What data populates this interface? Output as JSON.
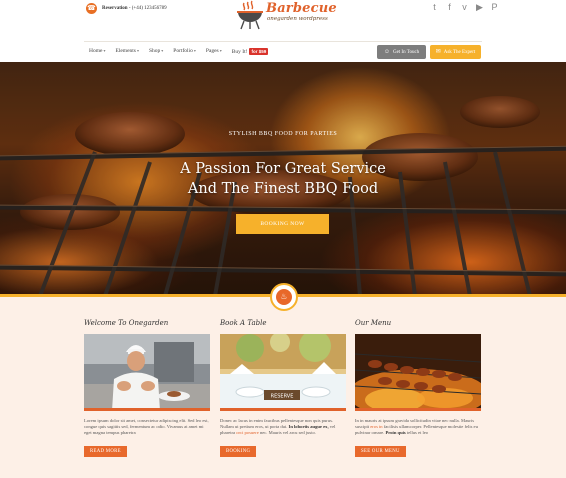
{
  "topbar": {
    "reservation_label": "Reservation",
    "reservation_phone": "- (+44) 123456789",
    "logo_title": "Barbecue",
    "logo_subtitle": "onegarden wordpress",
    "social_icons": [
      "twitter-icon",
      "facebook-icon",
      "vimeo-icon",
      "youtube-icon",
      "pinterest-icon"
    ],
    "social_glyphs": [
      "t",
      "f",
      "v",
      "▶",
      "P"
    ]
  },
  "nav": {
    "items": [
      "Home",
      "Elements",
      "Shop",
      "Portfolio",
      "Pages"
    ],
    "buy_label": "Buy It!",
    "buy_badge": "for $59",
    "get_in_touch": "Get In Touch",
    "ask_expert": "Ask The Expert"
  },
  "hero": {
    "kicker": "STYLISH BBQ FOOD FOR PARTIES",
    "title_line1": "A Passion For Great Service",
    "title_line2": "And The Finest BBQ Food",
    "button": "BOOKING NOW"
  },
  "columns": [
    {
      "title": "Welcome To Onegarden",
      "text_1": "Lorem ipsum dolor sit amet, consectetur adipiscing elit. Sed leo est, congue quis sagittis sed, fermentum ac odio. Vivamus at amet mi eget magna tempus pharetra",
      "button": "READ MORE"
    },
    {
      "title": "Book A Table",
      "text_1": "Donec ac lacus in enim faucibus pellentesque non quis purus. Nullam ut pretium eros, ut porta dui.",
      "text_hl_1": "In lobortis augue ex,",
      "text_2": "vel pharetra",
      "text_hl_2": "orci posuere",
      "text_3": "nec. Mauris vel arcu sed justo.",
      "button": "BOOKING"
    },
    {
      "title": "Our Menu",
      "text_1": "In in mauris at ipsum gravida sollicitudin vitae nec nulla. Mauris suscipit",
      "text_hl_1": "eros in",
      "text_2": "facilisis ullamcorper. Pellentesque molestie felis eu pulvinar ornare.",
      "text_bold": "Proin quis",
      "text_3": "tellus et leo",
      "button": "SEE OUR MENU"
    }
  ],
  "colors": {
    "accent_orange": "#e0622b",
    "accent_yellow": "#f6b12b",
    "cream_background": "#fdf0e7"
  }
}
